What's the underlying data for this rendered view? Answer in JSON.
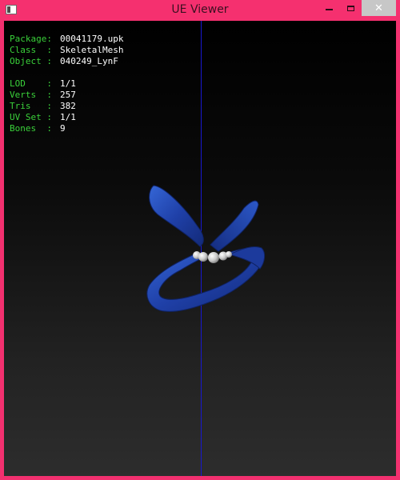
{
  "window": {
    "title": "UE Viewer",
    "close_glyph": "✕"
  },
  "info": {
    "package_label": "Package:",
    "package_value": "00041179.upk",
    "class_label": "Class  :",
    "class_value": "SkeletalMesh",
    "object_label": "Object :",
    "object_value": "040249_LynF",
    "lod_label": "LOD    :",
    "lod_value": "1/1",
    "verts_label": "Verts  :",
    "verts_value": "257",
    "tris_label": "Tris   :",
    "tris_value": "382",
    "uvset_label": "UV Set :",
    "uvset_value": "1/1",
    "bones_label": "Bones  :",
    "bones_value": "9"
  },
  "colors": {
    "window_border": "#f2306f",
    "label_green": "#3ad13a",
    "axis_blue": "#1818d0",
    "ribbon_blue": "#2349b8"
  },
  "icons": {
    "app": "app-icon",
    "minimize": "minimize-icon",
    "maximize": "maximize-icon",
    "close": "close-icon"
  }
}
